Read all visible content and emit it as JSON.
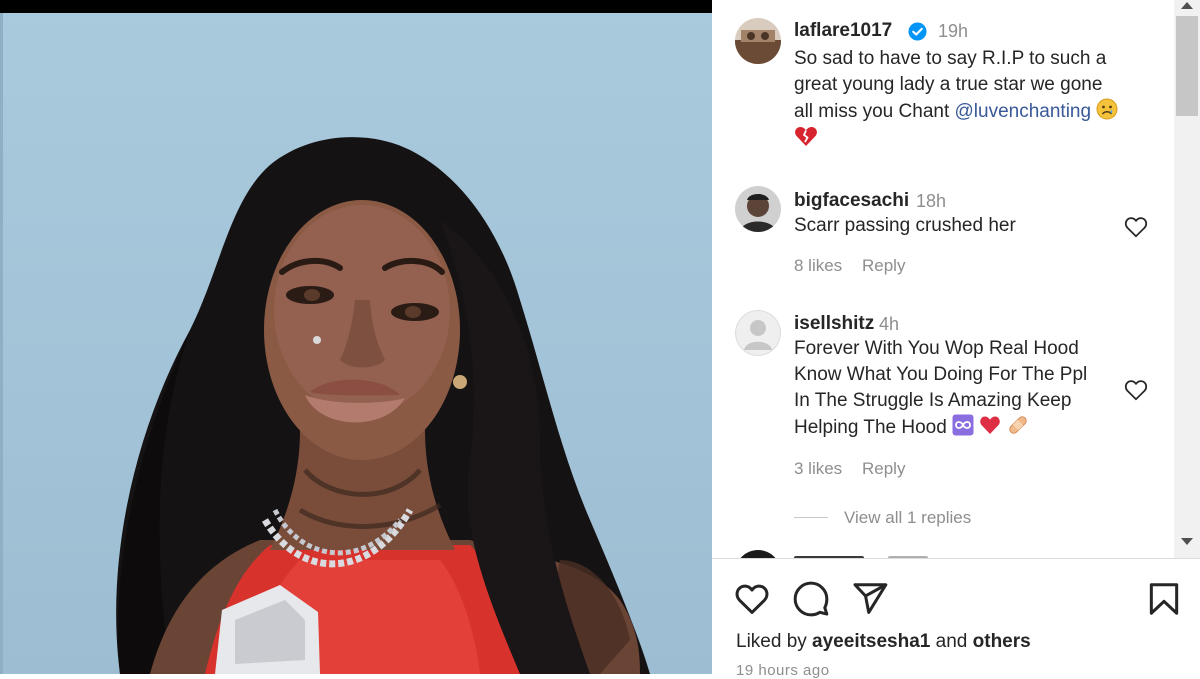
{
  "post": {
    "author": "laflare1017",
    "time": "19h",
    "caption_line1": "So sad to have to say R.I.P to such a",
    "caption_line2": "great young lady a true star we gone",
    "caption_line3_pre": "all miss you Chant ",
    "mention": "@luvenchanting",
    "emoji_sad": "sad-face-emoji",
    "emoji_broken_heart": "broken-heart-emoji"
  },
  "comments": [
    {
      "user": "bigfacesachi",
      "time": "18h",
      "text": "Scarr passing crushed her",
      "likes": "8 likes",
      "reply": "Reply"
    },
    {
      "user": "isellshitz",
      "time": "4h",
      "line1": "Forever With You Wop Real Hood",
      "line2": "Know What You Doing For The Ppl",
      "line3": "In The Struggle Is Amazing Keep",
      "line4": "Helping The Hood",
      "likes": "3 likes",
      "reply": "Reply",
      "view_replies": "View all 1 replies"
    }
  ],
  "footer": {
    "liked_prefix": "Liked by ",
    "liked_user": "ayeeitsesha1",
    "liked_mid": " and ",
    "liked_others": "others",
    "timestamp": "19 hours ago"
  },
  "icons": {
    "like": "heart-icon",
    "comment": "comment-icon",
    "share": "send-icon",
    "save": "bookmark-icon"
  },
  "colors": {
    "mention": "#385898",
    "muted": "#8e8e8e",
    "verified": "#0095f6",
    "heart": "#e0245e"
  }
}
